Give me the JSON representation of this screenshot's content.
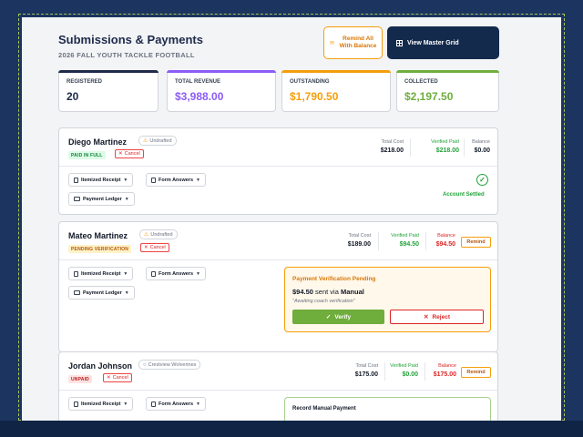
{
  "header": {
    "title": "Submissions & Payments",
    "subtitle": "2026 FALL YOUTH TACKLE FOOTBALL",
    "remind_all_label": "Remind All With Balance",
    "master_grid_label": "View Master Grid"
  },
  "stats": [
    {
      "label": "REGISTERED",
      "value": "20",
      "color": "#1e2a4a"
    },
    {
      "label": "TOTAL REVENUE",
      "value": "$3,988.00",
      "color": "#8b5cf6"
    },
    {
      "label": "OUTSTANDING",
      "value": "$1,790.50",
      "color": "#f59e0b"
    },
    {
      "label": "COLLECTED",
      "value": "$2,197.50",
      "color": "#6fad3c"
    }
  ],
  "labels": {
    "total_cost": "Total Cost",
    "verified_paid": "Verified Paid",
    "balance": "Balance",
    "cancel": "Cancel",
    "remind": "Remind",
    "itemized_receipt": "Itemized Receipt",
    "form_answers": "Form Answers",
    "payment_ledger": "Payment Ledger"
  },
  "submissions": [
    {
      "name": "Diego Martinez",
      "tag": "Undrafted",
      "status": "PAID IN FULL",
      "total_cost": "$218.00",
      "verified_paid": "$218.00",
      "balance": "$0.00",
      "settled_label": "Account Settled"
    },
    {
      "name": "Mateo Martinez",
      "tag": "Undrafted",
      "status": "PENDING VERIFICATION",
      "total_cost": "$189.00",
      "verified_paid": "$94.50",
      "balance": "$94.50",
      "verification": {
        "title": "Payment Verification Pending",
        "amount": "$94.50",
        "sent_via_text": "sent via",
        "method": "Manual",
        "note": "\"Awaiting coach verification\"",
        "verify_label": "Verify",
        "reject_label": "Reject"
      }
    },
    {
      "name": "Jordan Johnson",
      "tag": "Crestview Wolverines",
      "status": "UNPAID",
      "total_cost": "$175.00",
      "verified_paid": "$0.00",
      "balance": "$175.00",
      "manual_title": "Record Manual Payment"
    }
  ]
}
